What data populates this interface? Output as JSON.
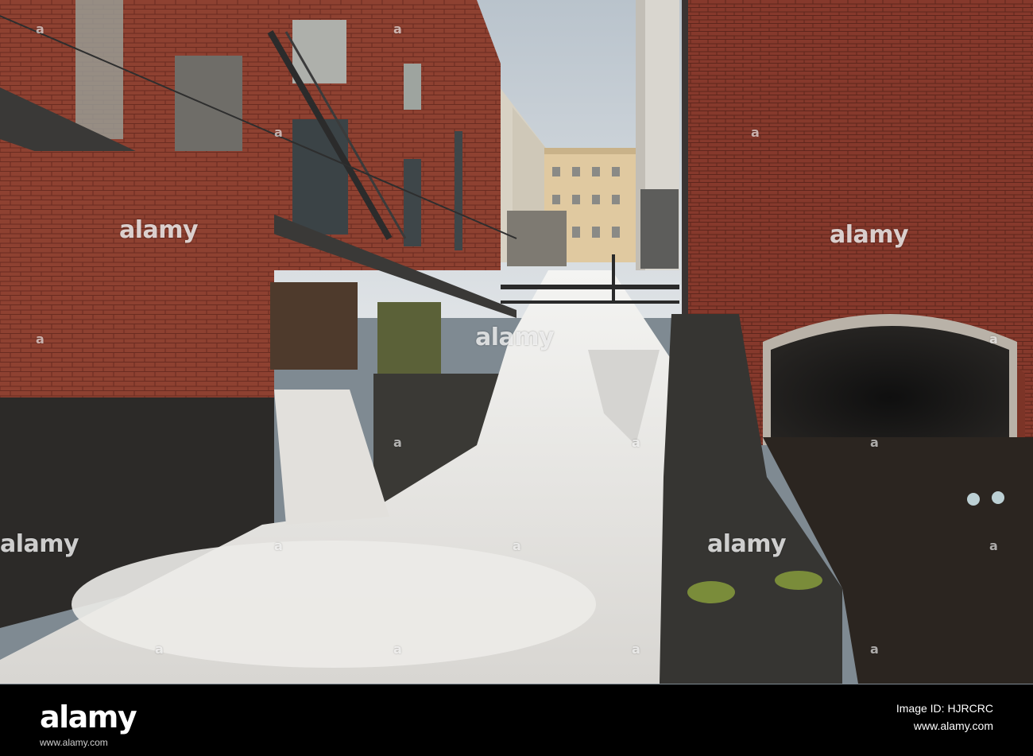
{
  "photo": {
    "description_colors": {
      "sky": "#c9d0d6",
      "brick": "#8a3d2e",
      "water": "#e8e6e1",
      "stone": "#2f2e2c"
    }
  },
  "watermarks": {
    "main": "alamy",
    "left": "alamy",
    "right": "alamy",
    "bottom": "alamy",
    "stock": "a"
  },
  "footer": {
    "brand": "alamy",
    "sub": "www.alamy.com",
    "id_line": "Image ID: HJRCRC",
    "id_line2": "www.alamy.com"
  }
}
